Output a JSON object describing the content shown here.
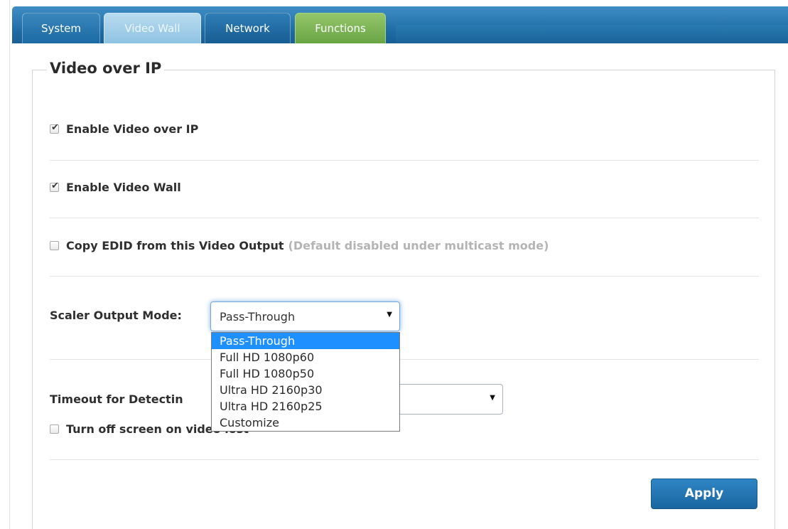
{
  "tabs": {
    "system": "System",
    "video_wall": "Video Wall",
    "network": "Network",
    "functions": "Functions"
  },
  "section_title": "Video over IP",
  "options": {
    "enable_vip": {
      "label": "Enable Video over IP",
      "checked": true
    },
    "enable_wall": {
      "label": "Enable Video Wall",
      "checked": true
    },
    "copy_edid": {
      "label": "Copy EDID from this Video Output",
      "note": "(Default disabled under multicast mode)",
      "checked": false
    }
  },
  "scaler": {
    "label": "Scaler Output Mode:",
    "value": "Pass-Through",
    "options": [
      "Pass-Through",
      "Full HD 1080p60",
      "Full HD 1080p50",
      "Ultra HD 2160p30",
      "Ultra HD 2160p25",
      "Customize"
    ]
  },
  "timeout": {
    "label": "Timeout for Detectin"
  },
  "turn_off": {
    "label": "Turn off screen on video lost",
    "checked": false
  },
  "apply_label": "Apply",
  "colors": {
    "tab_blue": "#1d6aa3",
    "tab_active": "#8ec3e3",
    "tab_green": "#6aa544",
    "highlight": "#1e90ff"
  }
}
